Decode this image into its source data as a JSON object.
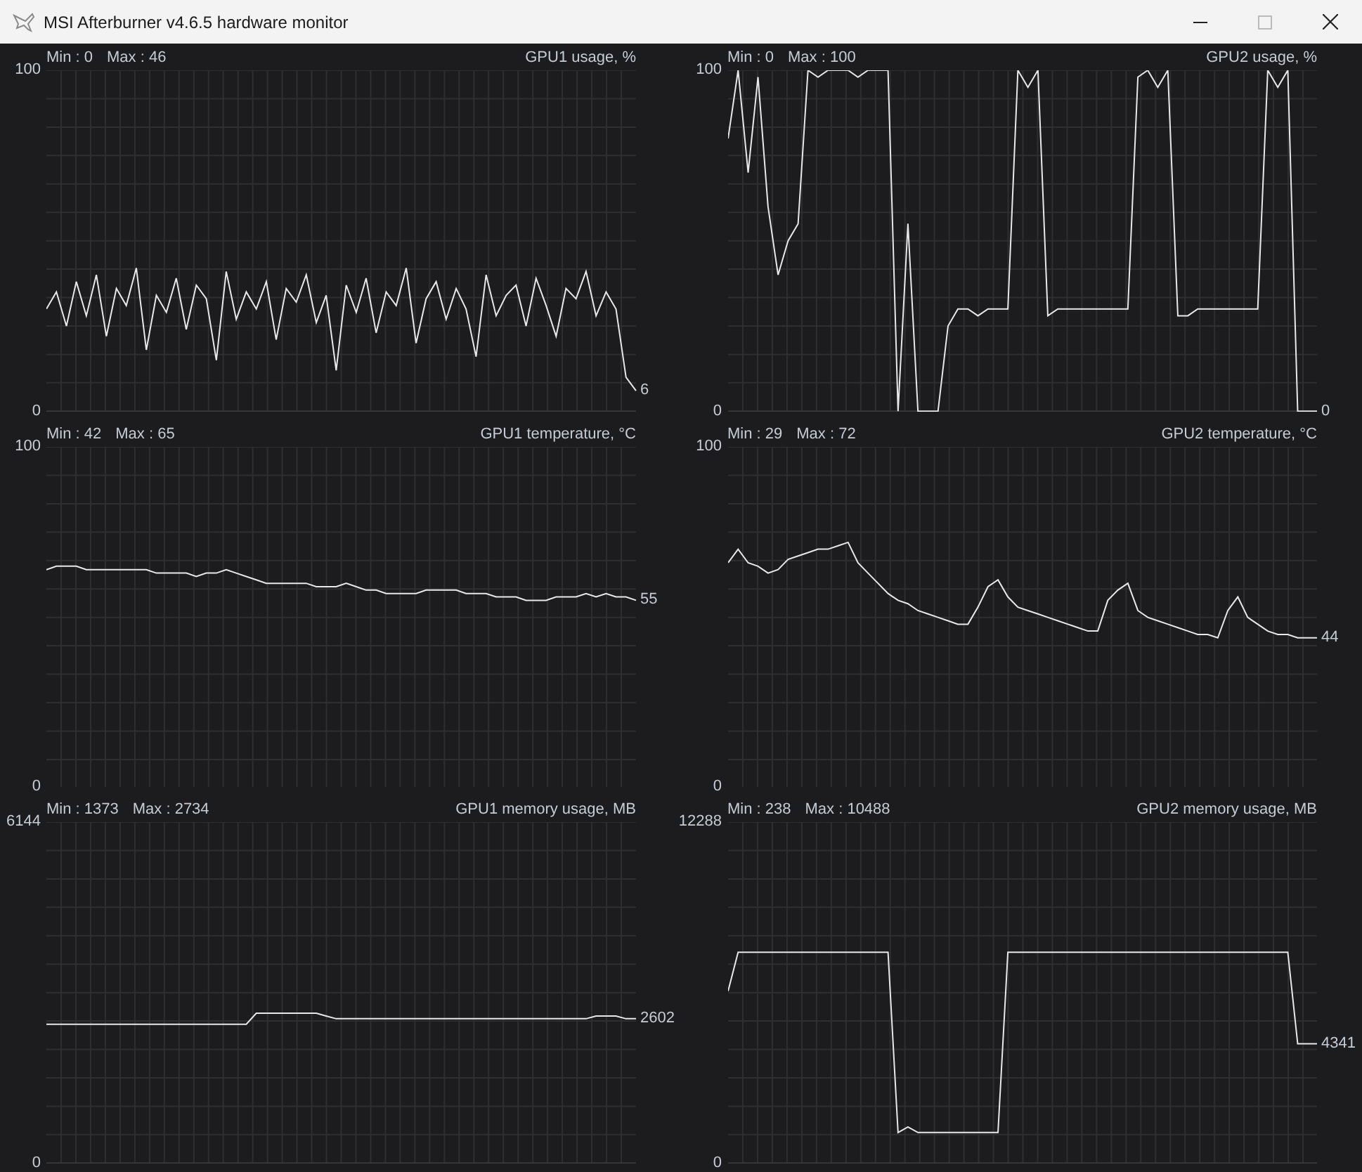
{
  "window": {
    "title": "MSI Afterburner v4.6.5 hardware monitor"
  },
  "graphs": [
    {
      "min": "Min : 0",
      "max": "Max : 46",
      "title": "GPU1 usage, %",
      "current": "6",
      "chart_data": {
        "type": "line",
        "grid": true,
        "yticks": [
          {
            "value": 0,
            "label": "0"
          },
          {
            "value": 100,
            "label": "100"
          }
        ],
        "ylim": [
          0,
          100
        ],
        "values": [
          30,
          35,
          25,
          38,
          28,
          40,
          22,
          36,
          31,
          42,
          18,
          34,
          29,
          39,
          24,
          37,
          33,
          15,
          41,
          27,
          35,
          30,
          38,
          21,
          36,
          32,
          40,
          26,
          34,
          12,
          37,
          29,
          39,
          23,
          35,
          31,
          42,
          20,
          33,
          38,
          27,
          36,
          30,
          16,
          40,
          28,
          34,
          37,
          25,
          39,
          31,
          22,
          36,
          33,
          41,
          28,
          35,
          30,
          10,
          6
        ]
      }
    },
    {
      "min": "Min : 0",
      "max": "Max : 100",
      "title": "GPU2 usage, %",
      "current": "0",
      "chart_data": {
        "type": "line",
        "grid": true,
        "yticks": [
          {
            "value": 0,
            "label": "0"
          },
          {
            "value": 100,
            "label": "100"
          }
        ],
        "ylim": [
          0,
          100
        ],
        "values": [
          80,
          100,
          70,
          98,
          60,
          40,
          50,
          55,
          100,
          98,
          100,
          100,
          100,
          98,
          100,
          100,
          100,
          0,
          55,
          0,
          0,
          0,
          25,
          30,
          30,
          28,
          30,
          30,
          30,
          100,
          95,
          100,
          28,
          30,
          30,
          30,
          30,
          30,
          30,
          30,
          30,
          98,
          100,
          95,
          100,
          28,
          28,
          30,
          30,
          30,
          30,
          30,
          30,
          30,
          100,
          95,
          100,
          0,
          0,
          0
        ]
      }
    },
    {
      "min": "Min : 42",
      "max": "Max : 65",
      "title": "GPU1 temperature, °C",
      "current": "55",
      "chart_data": {
        "type": "line",
        "grid": true,
        "yticks": [
          {
            "value": 0,
            "label": "0"
          },
          {
            "value": 100,
            "label": "100"
          }
        ],
        "ylim": [
          0,
          100
        ],
        "values": [
          64,
          65,
          65,
          65,
          64,
          64,
          64,
          64,
          64,
          64,
          64,
          63,
          63,
          63,
          63,
          62,
          63,
          63,
          64,
          63,
          62,
          61,
          60,
          60,
          60,
          60,
          60,
          59,
          59,
          59,
          60,
          59,
          58,
          58,
          57,
          57,
          57,
          57,
          58,
          58,
          58,
          58,
          57,
          57,
          57,
          56,
          56,
          56,
          55,
          55,
          55,
          56,
          56,
          56,
          57,
          56,
          57,
          56,
          56,
          55
        ]
      }
    },
    {
      "min": "Min : 29",
      "max": "Max : 72",
      "title": "GPU2 temperature, °C",
      "current": "44",
      "chart_data": {
        "type": "line",
        "grid": true,
        "yticks": [
          {
            "value": 0,
            "label": "0"
          },
          {
            "value": 100,
            "label": "100"
          }
        ],
        "ylim": [
          0,
          100
        ],
        "values": [
          66,
          70,
          66,
          65,
          63,
          64,
          67,
          68,
          69,
          70,
          70,
          71,
          72,
          66,
          63,
          60,
          57,
          55,
          54,
          52,
          51,
          50,
          49,
          48,
          48,
          53,
          59,
          61,
          56,
          53,
          52,
          51,
          50,
          49,
          48,
          47,
          46,
          46,
          55,
          58,
          60,
          52,
          50,
          49,
          48,
          47,
          46,
          45,
          45,
          44,
          52,
          56,
          50,
          48,
          46,
          45,
          45,
          44,
          44,
          44
        ]
      }
    },
    {
      "min": "Min : 1373",
      "max": "Max : 2734",
      "title": "GPU1 memory usage, MB",
      "current": "2602",
      "chart_data": {
        "type": "line",
        "grid": true,
        "yticks": [
          {
            "value": 0,
            "label": "0"
          },
          {
            "value": 6144,
            "label": "6144"
          }
        ],
        "ylim": [
          0,
          6144
        ],
        "values": [
          2500,
          2500,
          2500,
          2500,
          2500,
          2500,
          2500,
          2500,
          2500,
          2500,
          2500,
          2500,
          2500,
          2500,
          2500,
          2500,
          2500,
          2500,
          2500,
          2500,
          2500,
          2700,
          2700,
          2700,
          2700,
          2700,
          2700,
          2700,
          2650,
          2600,
          2600,
          2600,
          2600,
          2600,
          2600,
          2600,
          2600,
          2600,
          2600,
          2600,
          2600,
          2600,
          2600,
          2600,
          2600,
          2600,
          2600,
          2600,
          2600,
          2600,
          2600,
          2600,
          2600,
          2600,
          2600,
          2650,
          2650,
          2650,
          2600,
          2600
        ]
      }
    },
    {
      "min": "Min : 238",
      "max": "Max : 10488",
      "title": "GPU2 memory usage, MB",
      "current": "4341",
      "chart_data": {
        "type": "line",
        "grid": true,
        "yticks": [
          {
            "value": 0,
            "label": "0"
          },
          {
            "value": 12288,
            "label": "12288"
          }
        ],
        "ylim": [
          0,
          12288
        ],
        "values": [
          6200,
          7600,
          7600,
          7600,
          7600,
          7600,
          7600,
          7600,
          7600,
          7600,
          7600,
          7600,
          7600,
          7600,
          7600,
          7600,
          7600,
          1100,
          1300,
          1100,
          1100,
          1100,
          1100,
          1100,
          1100,
          1100,
          1100,
          1100,
          7600,
          7600,
          7600,
          7600,
          7600,
          7600,
          7600,
          7600,
          7600,
          7600,
          7600,
          7600,
          7600,
          7600,
          7600,
          7600,
          7600,
          7600,
          7600,
          7600,
          7600,
          7600,
          7600,
          7600,
          7600,
          7600,
          7600,
          7600,
          7600,
          4300,
          4300,
          4300
        ]
      }
    }
  ]
}
